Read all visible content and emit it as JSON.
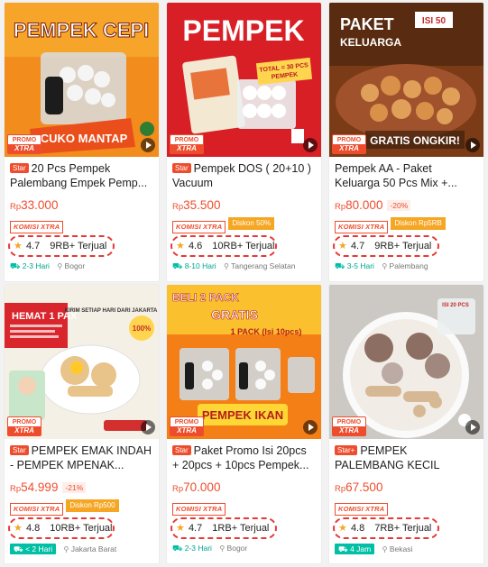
{
  "products": [
    {
      "image_text": "PEMPEK CEPI",
      "image_sub": "CUKO MANTAP",
      "promo": [
        "PROMO",
        "XTRA"
      ],
      "badge": "Star",
      "title": "20 Pcs Pempek Palembang Empek Pemp...",
      "price_currency": "Rp",
      "price": "33.000",
      "discount": "",
      "komisi": "KOMISI XTRA",
      "diskon": "",
      "rating": "4.7",
      "sold": "9RB+ Terjual",
      "ship_days": "2-3 Hari",
      "location": "Bogor",
      "colors": {
        "bg": "#f28c1c",
        "bg2": "#f6a52a"
      }
    },
    {
      "image_text": "PEMPEK",
      "image_sub": "TOTAL = 30 PCS PEMPEK",
      "promo": [
        "PROMO",
        "XTRA"
      ],
      "badge": "Star",
      "title": "Pempek DOS ( 20+10 ) Vacuum",
      "price_currency": "Rp",
      "price": "35.500",
      "discount": "",
      "komisi": "KOMISI XTRA",
      "diskon": "Diskon 50%",
      "rating": "4.6",
      "sold": "10RB+ Terjual",
      "ship_days": "8-10 Hari",
      "location": "Tangerang Selatan",
      "colors": {
        "bg": "#d81f26",
        "bg2": "#e23a2a"
      }
    },
    {
      "image_text": "PAKET KELUARGA",
      "image_sub": "GRATIS ONGKIR!",
      "image_badge": "ISI 50",
      "promo": [
        "PROMO",
        "XTRA"
      ],
      "badge": "",
      "title": "Pempek AA - Paket Keluarga 50 Pcs Mix +...",
      "price_currency": "Rp",
      "price": "80.000",
      "discount": "-20%",
      "komisi": "KOMISI XTRA",
      "diskon": "Diskon Rp5RB",
      "rating": "4.7",
      "sold": "9RB+ Terjual",
      "ship_days": "3-5 Hari",
      "location": "Palembang",
      "colors": {
        "bg": "#7a3b16",
        "bg2": "#c0692a"
      }
    },
    {
      "image_text": "HEMAT 1 PAX",
      "image_sub": "KIRIM SETIAP HARI DARI JAKARTA",
      "promo": [
        "PROMO",
        "XTRA"
      ],
      "badge": "Star",
      "title": "PEMPEK EMAK INDAH - PEMPEK MPENAK...",
      "price_currency": "Rp",
      "price": "54.999",
      "discount": "-21%",
      "komisi": "KOMISI XTRA",
      "diskon": "Diskon Rp500",
      "rating": "4.8",
      "sold": "10RB+ Terjual",
      "ship_days": "< 2 Hari",
      "location": "Jakarta Barat",
      "colors": {
        "bg": "#f5f0e6",
        "bg2": "#d9262d"
      }
    },
    {
      "image_text": "BELI 2 PACK GRATIS",
      "image_sub": "PEMPEK IKAN",
      "promo": [
        "PROMO",
        "XTRA"
      ],
      "badge": "Star",
      "title": "Paket Promo Isi 20pcs + 20pcs + 10pcs Pempek...",
      "price_currency": "Rp",
      "price": "70.000",
      "discount": "",
      "komisi": "KOMISI XTRA",
      "diskon": "",
      "rating": "4.7",
      "sold": "1RB+ Terjual",
      "ship_days": "2-3 Hari",
      "location": "Bogor",
      "colors": {
        "bg": "#f57f17",
        "bg2": "#fbc02d"
      }
    },
    {
      "image_text": "ISI 20 PCS",
      "image_sub": "",
      "promo": [
        "PROMO",
        "XTRA"
      ],
      "badge": "Star+",
      "title": "PEMPEK PALEMBANG KECIL PAKE...",
      "price_currency": "Rp",
      "price": "67.500",
      "discount": "",
      "komisi": "KOMISI XTRA",
      "diskon": "",
      "rating": "4.8",
      "sold": "7RB+ Terjual",
      "ship_days": "4 Jam",
      "location": "Bekasi",
      "colors": {
        "bg": "#c62828",
        "bg2": "#e8d9c0"
      }
    }
  ]
}
